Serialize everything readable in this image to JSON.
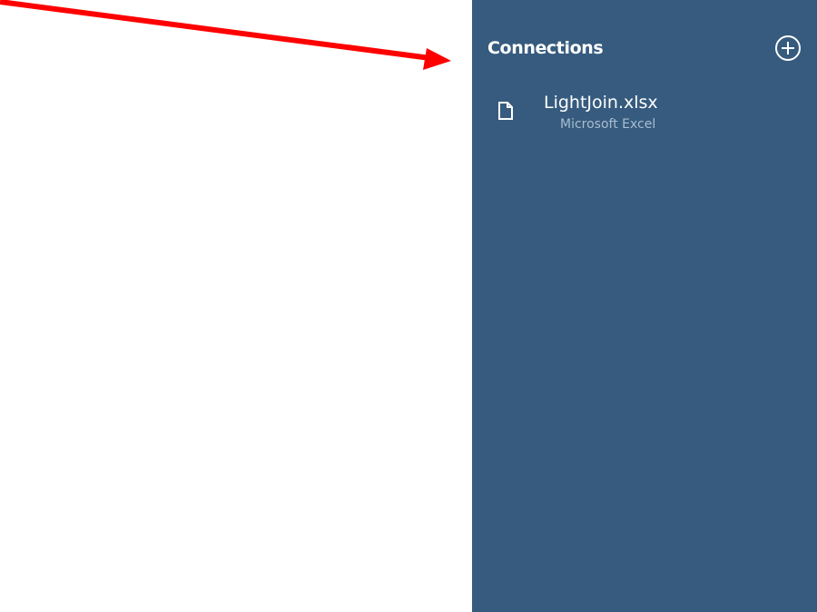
{
  "sidebar": {
    "title": "Connections",
    "add_button_icon": "plus-circle-icon",
    "connections": [
      {
        "name": "LightJoin.xlsx",
        "type": "Microsoft Excel",
        "icon": "file-icon"
      }
    ]
  },
  "annotation": {
    "arrow_color": "#ff0000"
  },
  "colors": {
    "sidebar_background": "#365b7e",
    "text_primary": "#ffffff",
    "text_secondary": "#a9bdd0"
  }
}
